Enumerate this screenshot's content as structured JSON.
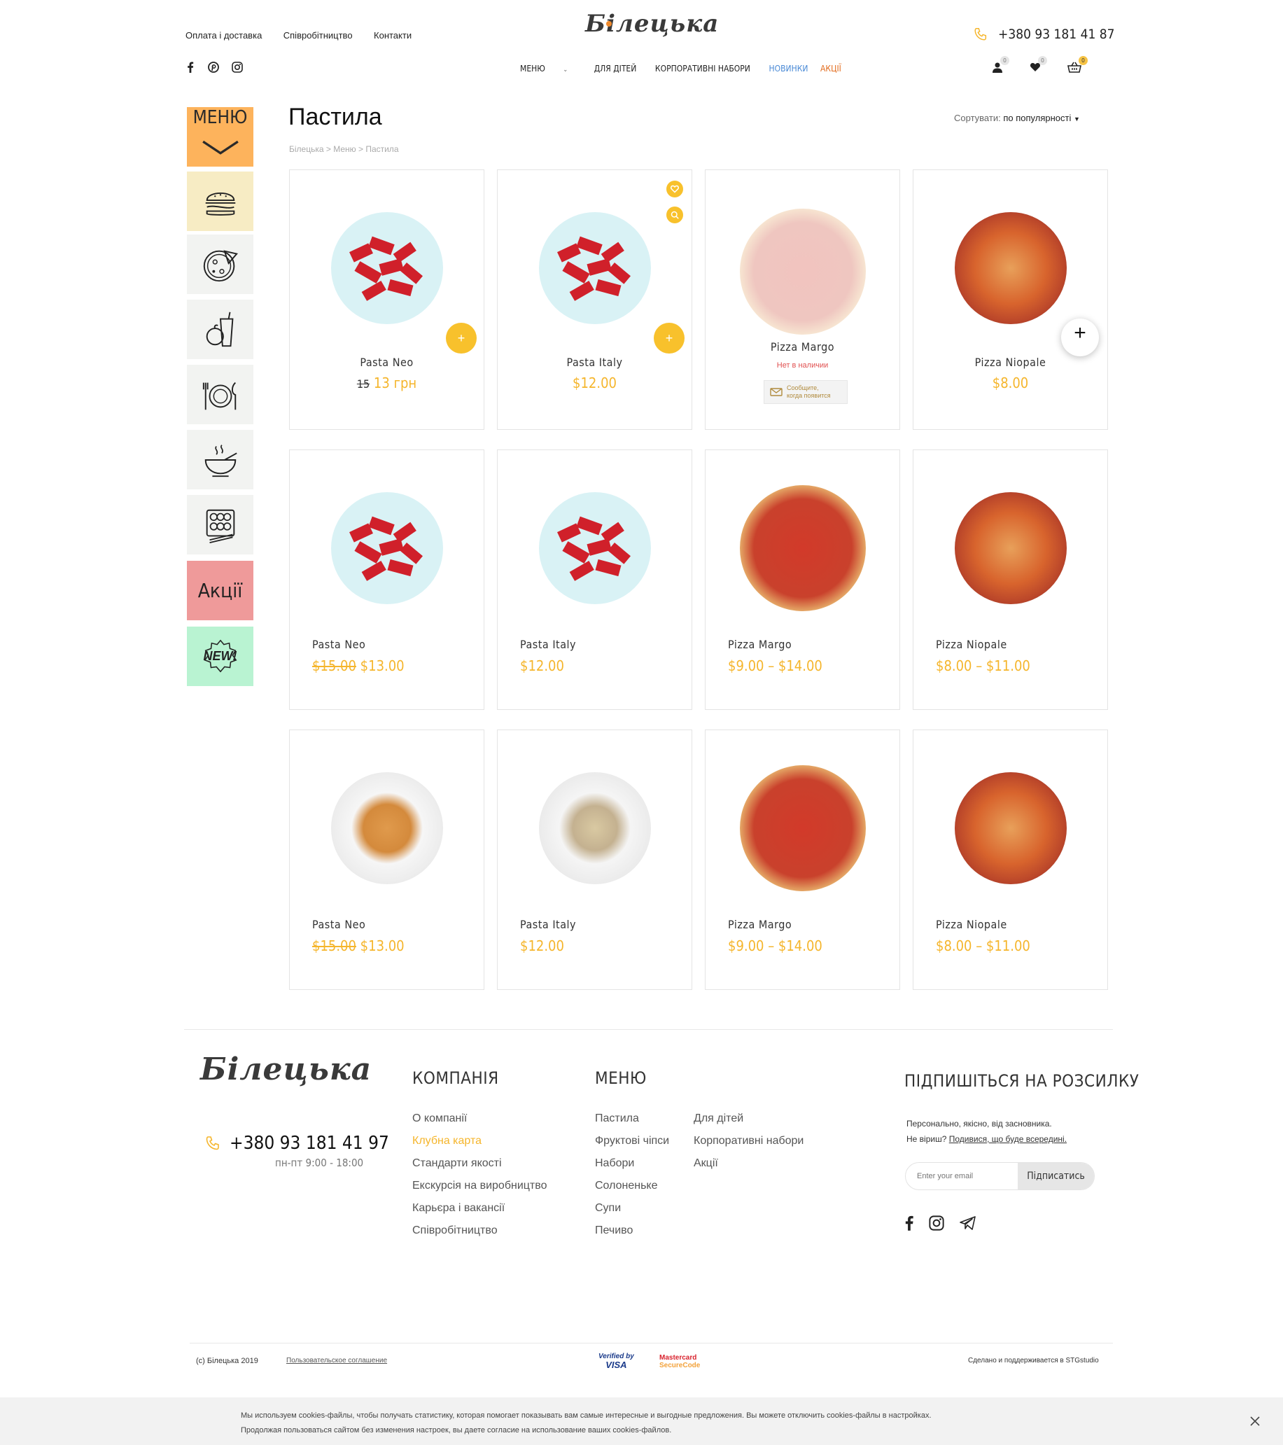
{
  "header": {
    "top_links": [
      "Оплата і доставка",
      "Співробітництво",
      "Контакти"
    ],
    "logo": "Білецька",
    "phone": "+380 93 181 41 87",
    "nav": [
      "МЕНЮ",
      "ДЛЯ ДІТЕЙ",
      "КОРПОРАТИВНІ НАБОРИ",
      "НОВИНКИ",
      "АКЦІЇ"
    ],
    "badges": {
      "account": "0",
      "wishlist": "0",
      "cart": "0"
    }
  },
  "sidebar": {
    "menu_label": "МЕНЮ",
    "promo_label": "Акції",
    "new_label": "NEW!",
    "icons": [
      "burger-icon",
      "pizza-icon",
      "drinks-icon",
      "plate-icon",
      "soup-icon",
      "sushi-icon"
    ]
  },
  "page": {
    "title": "Пастила",
    "breadcrumb": "Білецька > Меню > Пастила",
    "sort_label": "Сортувати:",
    "sort_value": "по популярності"
  },
  "products": [
    {
      "name": "Pasta Neo",
      "old_price": "15",
      "price": "13 грн"
    },
    {
      "name": "Pasta Italy",
      "price": "$12.00"
    },
    {
      "name": "Pizza Margo",
      "stock": "Нет в наличии",
      "notify_line1": "Сообщите,",
      "notify_line2": "когда появится"
    },
    {
      "name": "Pizza Niopale",
      "price": "$8.00"
    },
    {
      "name": "Pasta Neo",
      "old_price": "$15.00",
      "price": "$13.00"
    },
    {
      "name": "Pasta Italy",
      "price": "$12.00"
    },
    {
      "name": "Pizza Margo",
      "price": "$9.00 – $14.00"
    },
    {
      "name": "Pizza Niopale",
      "price": "$8.00 – $11.00"
    },
    {
      "name": "Pasta Neo",
      "old_price": "$15.00",
      "price": "$13.00"
    },
    {
      "name": "Pasta Italy",
      "price": "$12.00"
    },
    {
      "name": "Pizza Margo",
      "price": "$9.00 – $14.00"
    },
    {
      "name": "Pizza Niopale",
      "price": "$8.00 – $11.00"
    }
  ],
  "footer": {
    "logo": "Білецька",
    "phone": "+380 93 181 41 97",
    "hours": "пн-пт 9:00 - 18:00",
    "company_title": "КОМПАНІЯ",
    "company_links": [
      "О компанії",
      "Клубна карта",
      "Стандарти якості",
      "Екскурсія на виробництво",
      "Карьєра і вакансії",
      "Співробітництво"
    ],
    "menu_title": "МЕНЮ",
    "menu_col1": [
      "Пастила",
      "Фруктові чіпси",
      "Набори",
      "Солоненьке",
      "Супи",
      "Печиво"
    ],
    "menu_col2": [
      "Для дітей",
      "Корпоративні набори",
      "Акції"
    ],
    "subscribe_title": "ПІДПИШІТЬСЯ НА РОЗСИЛКУ",
    "subscribe_text1": "Персонально, якісно, від засновника.",
    "subscribe_text2": "Не віриш?",
    "subscribe_link": "Подивися, що буде всередині.",
    "email_placeholder": "Enter your email",
    "subscribe_button": "Підписатись",
    "copyright": "(c) Білецька 2019",
    "agreement": "Пользовательское соглашение",
    "visa_top": "Verified by",
    "visa_bottom": "VISA",
    "mc_top": "Mastercard",
    "mc_bottom": "SecureCode",
    "made_by": "Сделано и поддерживается в STGstudio"
  },
  "cookie": {
    "line1": "Мы используем cookies-файлы, чтобы получать статистику, которая помогает показывать вам самые интересные и выгодные предложения. Вы можете отключить cookies-файлы в настройках.",
    "line2": "Продолжая пользоваться сайтом без изменения настроек, вы даете согласие на использование ваших cookies-файлов."
  },
  "colors": {
    "accent": "#f5b52b",
    "menu_tile": "#fdb35c",
    "burger_tile": "#f7ecc4",
    "promo_tile": "#ef9a9a",
    "new_tile": "#b9f3d2"
  }
}
